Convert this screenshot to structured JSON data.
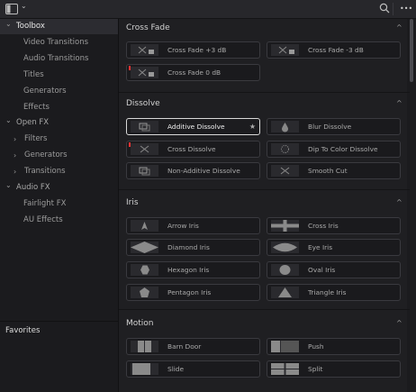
{
  "sidebar": {
    "items": [
      {
        "label": "Toolbox",
        "chevron": "⌄",
        "level": "root",
        "selected": true
      },
      {
        "label": "Video Transitions",
        "level": "child"
      },
      {
        "label": "Audio Transitions",
        "level": "child"
      },
      {
        "label": "Titles",
        "level": "child"
      },
      {
        "label": "Generators",
        "level": "child"
      },
      {
        "label": "Effects",
        "level": "child"
      },
      {
        "label": "Open FX",
        "chevron": "⌄",
        "level": "root"
      },
      {
        "label": "Filters",
        "chevron": "›",
        "level": "sub"
      },
      {
        "label": "Generators",
        "chevron": "›",
        "level": "sub"
      },
      {
        "label": "Transitions",
        "chevron": "›",
        "level": "sub"
      },
      {
        "label": "Audio FX",
        "chevron": "⌄",
        "level": "root"
      },
      {
        "label": "Fairlight FX",
        "level": "child"
      },
      {
        "label": "AU Effects",
        "level": "child"
      }
    ],
    "favorites_label": "Favorites"
  },
  "sections": [
    {
      "title": "Cross Fade",
      "chevron": "^",
      "items": [
        {
          "label": "Cross Fade +3 dB",
          "icon": "audio-crossfade-icon"
        },
        {
          "label": "Cross Fade -3 dB",
          "icon": "audio-crossfade-icon"
        },
        {
          "label": "Cross Fade 0 dB",
          "icon": "audio-crossfade-icon",
          "warn": true
        }
      ]
    },
    {
      "title": "Dissolve",
      "chevron": "^",
      "items": [
        {
          "label": "Additive Dissolve",
          "icon": "dissolve-icon",
          "selected": true,
          "star": "★"
        },
        {
          "label": "Blur Dissolve",
          "icon": "blur-drop-icon"
        },
        {
          "label": "Cross Dissolve",
          "icon": "cross-dissolve-icon",
          "warn": true
        },
        {
          "label": "Dip To Color Dissolve",
          "icon": "dotted-circle-icon"
        },
        {
          "label": "Non-Additive Dissolve",
          "icon": "dissolve-icon"
        },
        {
          "label": "Smooth Cut",
          "icon": "cross-dissolve-icon"
        }
      ]
    },
    {
      "title": "Iris",
      "chevron": "^",
      "items": [
        {
          "label": "Arrow Iris",
          "icon": "arrow-iris-icon"
        },
        {
          "label": "Cross Iris",
          "icon": "cross-iris-icon"
        },
        {
          "label": "Diamond Iris",
          "icon": "diamond-iris-icon"
        },
        {
          "label": "Eye Iris",
          "icon": "eye-iris-icon"
        },
        {
          "label": "Hexagon Iris",
          "icon": "hexagon-iris-icon"
        },
        {
          "label": "Oval Iris",
          "icon": "oval-iris-icon"
        },
        {
          "label": "Pentagon Iris",
          "icon": "pentagon-iris-icon"
        },
        {
          "label": "Triangle Iris",
          "icon": "triangle-iris-icon"
        }
      ]
    },
    {
      "title": "Motion",
      "chevron": "^",
      "items": [
        {
          "label": "Barn Door",
          "icon": "barn-door-icon"
        },
        {
          "label": "Push",
          "icon": "push-icon"
        },
        {
          "label": "Slide",
          "icon": "slide-icon"
        },
        {
          "label": "Split",
          "icon": "split-icon"
        }
      ]
    }
  ],
  "toolbar": {
    "panel_icon": "panel-toggle-icon",
    "panel_chevron": "⌄",
    "search_icon": "search-icon",
    "more_label": "•••"
  },
  "colors": {
    "accent_warn": "#e33333",
    "selected_border": "#d9d9d9",
    "background": "#1f1f22"
  }
}
